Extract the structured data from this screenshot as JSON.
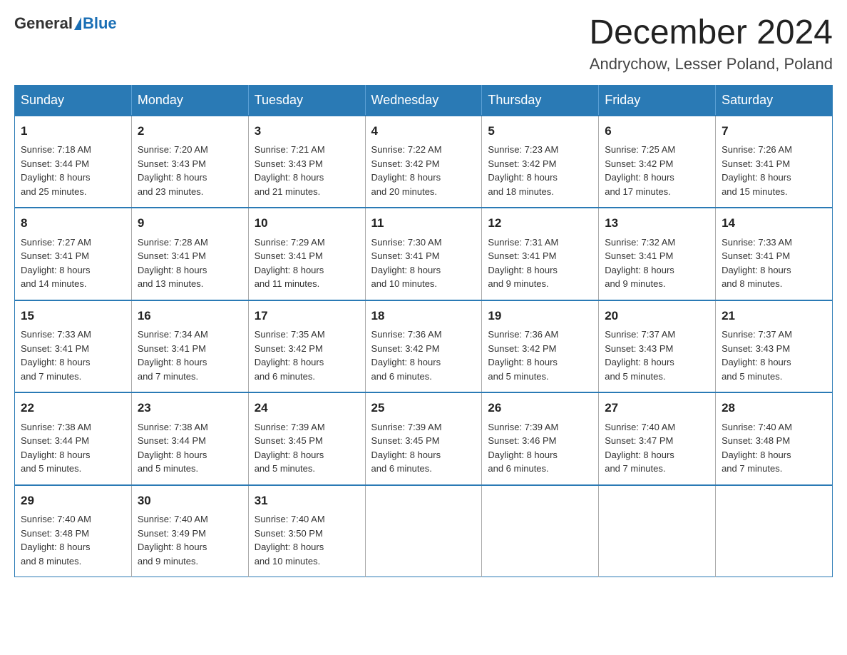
{
  "header": {
    "logo_general": "General",
    "logo_blue": "Blue",
    "month_title": "December 2024",
    "location": "Andrychow, Lesser Poland, Poland"
  },
  "weekdays": [
    "Sunday",
    "Monday",
    "Tuesday",
    "Wednesday",
    "Thursday",
    "Friday",
    "Saturday"
  ],
  "weeks": [
    [
      {
        "day": "1",
        "sunrise": "7:18 AM",
        "sunset": "3:44 PM",
        "daylight": "8 hours and 25 minutes."
      },
      {
        "day": "2",
        "sunrise": "7:20 AM",
        "sunset": "3:43 PM",
        "daylight": "8 hours and 23 minutes."
      },
      {
        "day": "3",
        "sunrise": "7:21 AM",
        "sunset": "3:43 PM",
        "daylight": "8 hours and 21 minutes."
      },
      {
        "day": "4",
        "sunrise": "7:22 AM",
        "sunset": "3:42 PM",
        "daylight": "8 hours and 20 minutes."
      },
      {
        "day": "5",
        "sunrise": "7:23 AM",
        "sunset": "3:42 PM",
        "daylight": "8 hours and 18 minutes."
      },
      {
        "day": "6",
        "sunrise": "7:25 AM",
        "sunset": "3:42 PM",
        "daylight": "8 hours and 17 minutes."
      },
      {
        "day": "7",
        "sunrise": "7:26 AM",
        "sunset": "3:41 PM",
        "daylight": "8 hours and 15 minutes."
      }
    ],
    [
      {
        "day": "8",
        "sunrise": "7:27 AM",
        "sunset": "3:41 PM",
        "daylight": "8 hours and 14 minutes."
      },
      {
        "day": "9",
        "sunrise": "7:28 AM",
        "sunset": "3:41 PM",
        "daylight": "8 hours and 13 minutes."
      },
      {
        "day": "10",
        "sunrise": "7:29 AM",
        "sunset": "3:41 PM",
        "daylight": "8 hours and 11 minutes."
      },
      {
        "day": "11",
        "sunrise": "7:30 AM",
        "sunset": "3:41 PM",
        "daylight": "8 hours and 10 minutes."
      },
      {
        "day": "12",
        "sunrise": "7:31 AM",
        "sunset": "3:41 PM",
        "daylight": "8 hours and 9 minutes."
      },
      {
        "day": "13",
        "sunrise": "7:32 AM",
        "sunset": "3:41 PM",
        "daylight": "8 hours and 9 minutes."
      },
      {
        "day": "14",
        "sunrise": "7:33 AM",
        "sunset": "3:41 PM",
        "daylight": "8 hours and 8 minutes."
      }
    ],
    [
      {
        "day": "15",
        "sunrise": "7:33 AM",
        "sunset": "3:41 PM",
        "daylight": "8 hours and 7 minutes."
      },
      {
        "day": "16",
        "sunrise": "7:34 AM",
        "sunset": "3:41 PM",
        "daylight": "8 hours and 7 minutes."
      },
      {
        "day": "17",
        "sunrise": "7:35 AM",
        "sunset": "3:42 PM",
        "daylight": "8 hours and 6 minutes."
      },
      {
        "day": "18",
        "sunrise": "7:36 AM",
        "sunset": "3:42 PM",
        "daylight": "8 hours and 6 minutes."
      },
      {
        "day": "19",
        "sunrise": "7:36 AM",
        "sunset": "3:42 PM",
        "daylight": "8 hours and 5 minutes."
      },
      {
        "day": "20",
        "sunrise": "7:37 AM",
        "sunset": "3:43 PM",
        "daylight": "8 hours and 5 minutes."
      },
      {
        "day": "21",
        "sunrise": "7:37 AM",
        "sunset": "3:43 PM",
        "daylight": "8 hours and 5 minutes."
      }
    ],
    [
      {
        "day": "22",
        "sunrise": "7:38 AM",
        "sunset": "3:44 PM",
        "daylight": "8 hours and 5 minutes."
      },
      {
        "day": "23",
        "sunrise": "7:38 AM",
        "sunset": "3:44 PM",
        "daylight": "8 hours and 5 minutes."
      },
      {
        "day": "24",
        "sunrise": "7:39 AM",
        "sunset": "3:45 PM",
        "daylight": "8 hours and 5 minutes."
      },
      {
        "day": "25",
        "sunrise": "7:39 AM",
        "sunset": "3:45 PM",
        "daylight": "8 hours and 6 minutes."
      },
      {
        "day": "26",
        "sunrise": "7:39 AM",
        "sunset": "3:46 PM",
        "daylight": "8 hours and 6 minutes."
      },
      {
        "day": "27",
        "sunrise": "7:40 AM",
        "sunset": "3:47 PM",
        "daylight": "8 hours and 7 minutes."
      },
      {
        "day": "28",
        "sunrise": "7:40 AM",
        "sunset": "3:48 PM",
        "daylight": "8 hours and 7 minutes."
      }
    ],
    [
      {
        "day": "29",
        "sunrise": "7:40 AM",
        "sunset": "3:48 PM",
        "daylight": "8 hours and 8 minutes."
      },
      {
        "day": "30",
        "sunrise": "7:40 AM",
        "sunset": "3:49 PM",
        "daylight": "8 hours and 9 minutes."
      },
      {
        "day": "31",
        "sunrise": "7:40 AM",
        "sunset": "3:50 PM",
        "daylight": "8 hours and 10 minutes."
      },
      null,
      null,
      null,
      null
    ]
  ],
  "labels": {
    "sunrise": "Sunrise:",
    "sunset": "Sunset:",
    "daylight": "Daylight:"
  }
}
